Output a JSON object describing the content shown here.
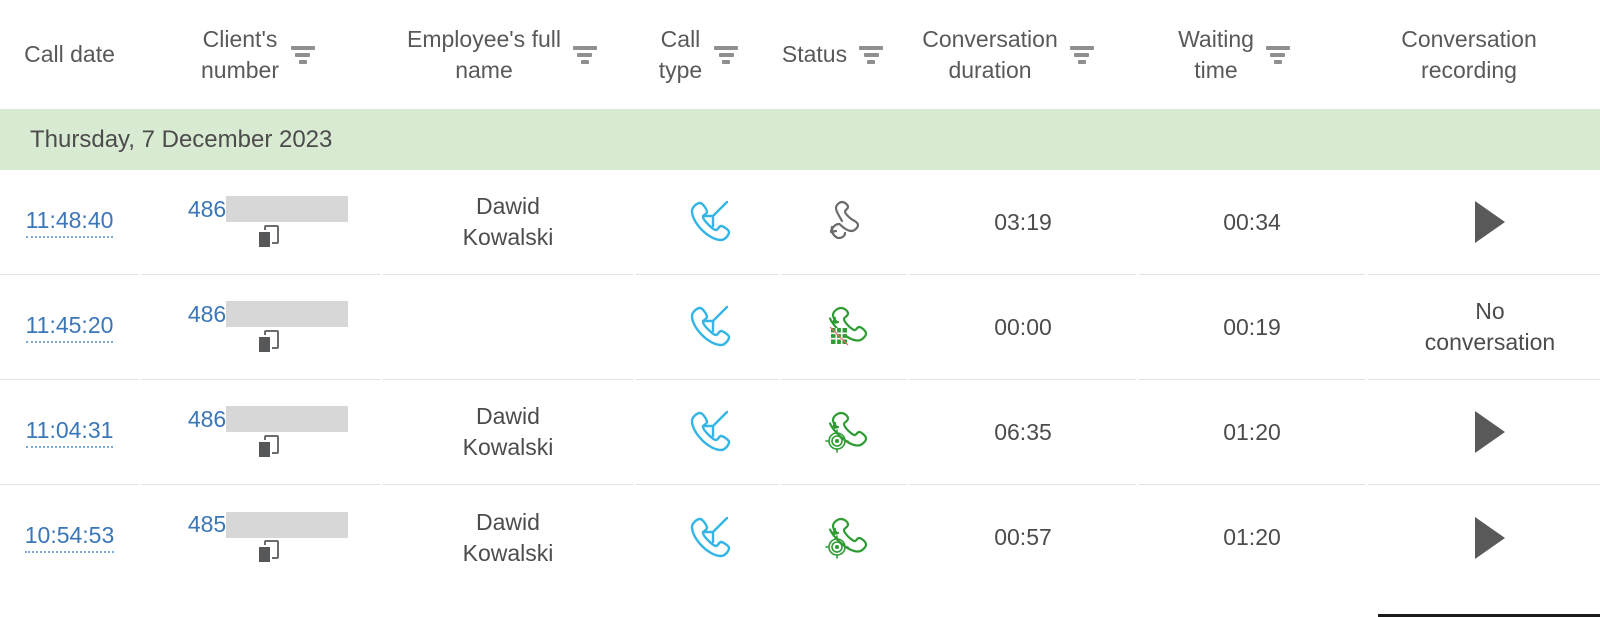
{
  "table": {
    "columns": [
      {
        "label": "Call date",
        "filter": false,
        "key": "call_date"
      },
      {
        "label": "Client's\nnumber",
        "filter": true,
        "key": "client_number"
      },
      {
        "label": "Employee's full\nname",
        "filter": true,
        "key": "employee_name"
      },
      {
        "label": "Call\ntype",
        "filter": true,
        "key": "call_type"
      },
      {
        "label": "Status",
        "filter": true,
        "key": "status"
      },
      {
        "label": "Conversation\nduration",
        "filter": true,
        "key": "conversation_duration"
      },
      {
        "label": "Waiting\ntime",
        "filter": true,
        "key": "waiting_time"
      },
      {
        "label": "Conversation\nrecording",
        "filter": false,
        "key": "conversation_recording"
      }
    ],
    "group_header": "Thursday, 7 December 2023",
    "rows": [
      {
        "call_date": "11:48:40",
        "number_prefix": "486",
        "number_masked": true,
        "copy_icon": "copy-icon",
        "employee_name": "Dawid\nKowalski",
        "call_type_icon": "incoming-call-icon",
        "status_icon": "transferred-call-icon",
        "conversation_duration": "03:19",
        "waiting_time": "00:34",
        "recording": "play-icon",
        "recording_text": ""
      },
      {
        "call_date": "11:45:20",
        "number_prefix": "486",
        "number_masked": true,
        "copy_icon": "copy-icon",
        "employee_name": "",
        "call_type_icon": "incoming-call-icon",
        "status_icon": "missed-call-keypad-icon",
        "conversation_duration": "00:00",
        "waiting_time": "00:19",
        "recording": "none",
        "recording_text": "No\nconversation"
      },
      {
        "call_date": "11:04:31",
        "number_prefix": "486",
        "number_masked": true,
        "copy_icon": "copy-icon",
        "employee_name": "Dawid\nKowalski",
        "call_type_icon": "incoming-call-icon",
        "status_icon": "answered-call-icon",
        "conversation_duration": "06:35",
        "waiting_time": "01:20",
        "recording": "play-icon",
        "recording_text": ""
      },
      {
        "call_date": "10:54:53",
        "number_prefix": "485",
        "number_masked": true,
        "copy_icon": "copy-icon",
        "employee_name": "Dawid\nKowalski",
        "call_type_icon": "incoming-call-icon",
        "status_icon": "answered-call-icon",
        "conversation_duration": "00:57",
        "waiting_time": "01:20",
        "recording": "play-icon",
        "recording_text": ""
      }
    ]
  },
  "colors": {
    "group_band": "#d9ead3",
    "link_blue": "#3a76b8",
    "incoming_call_blue": "#33b5e5",
    "status_green": "#2e9b33",
    "status_gray": "#6b6b6b",
    "text_gray": "#4c4c4c",
    "header_gray": "#58595b",
    "redaction_gray": "#d7d7d7",
    "row_divider": "#e2e2e2"
  }
}
